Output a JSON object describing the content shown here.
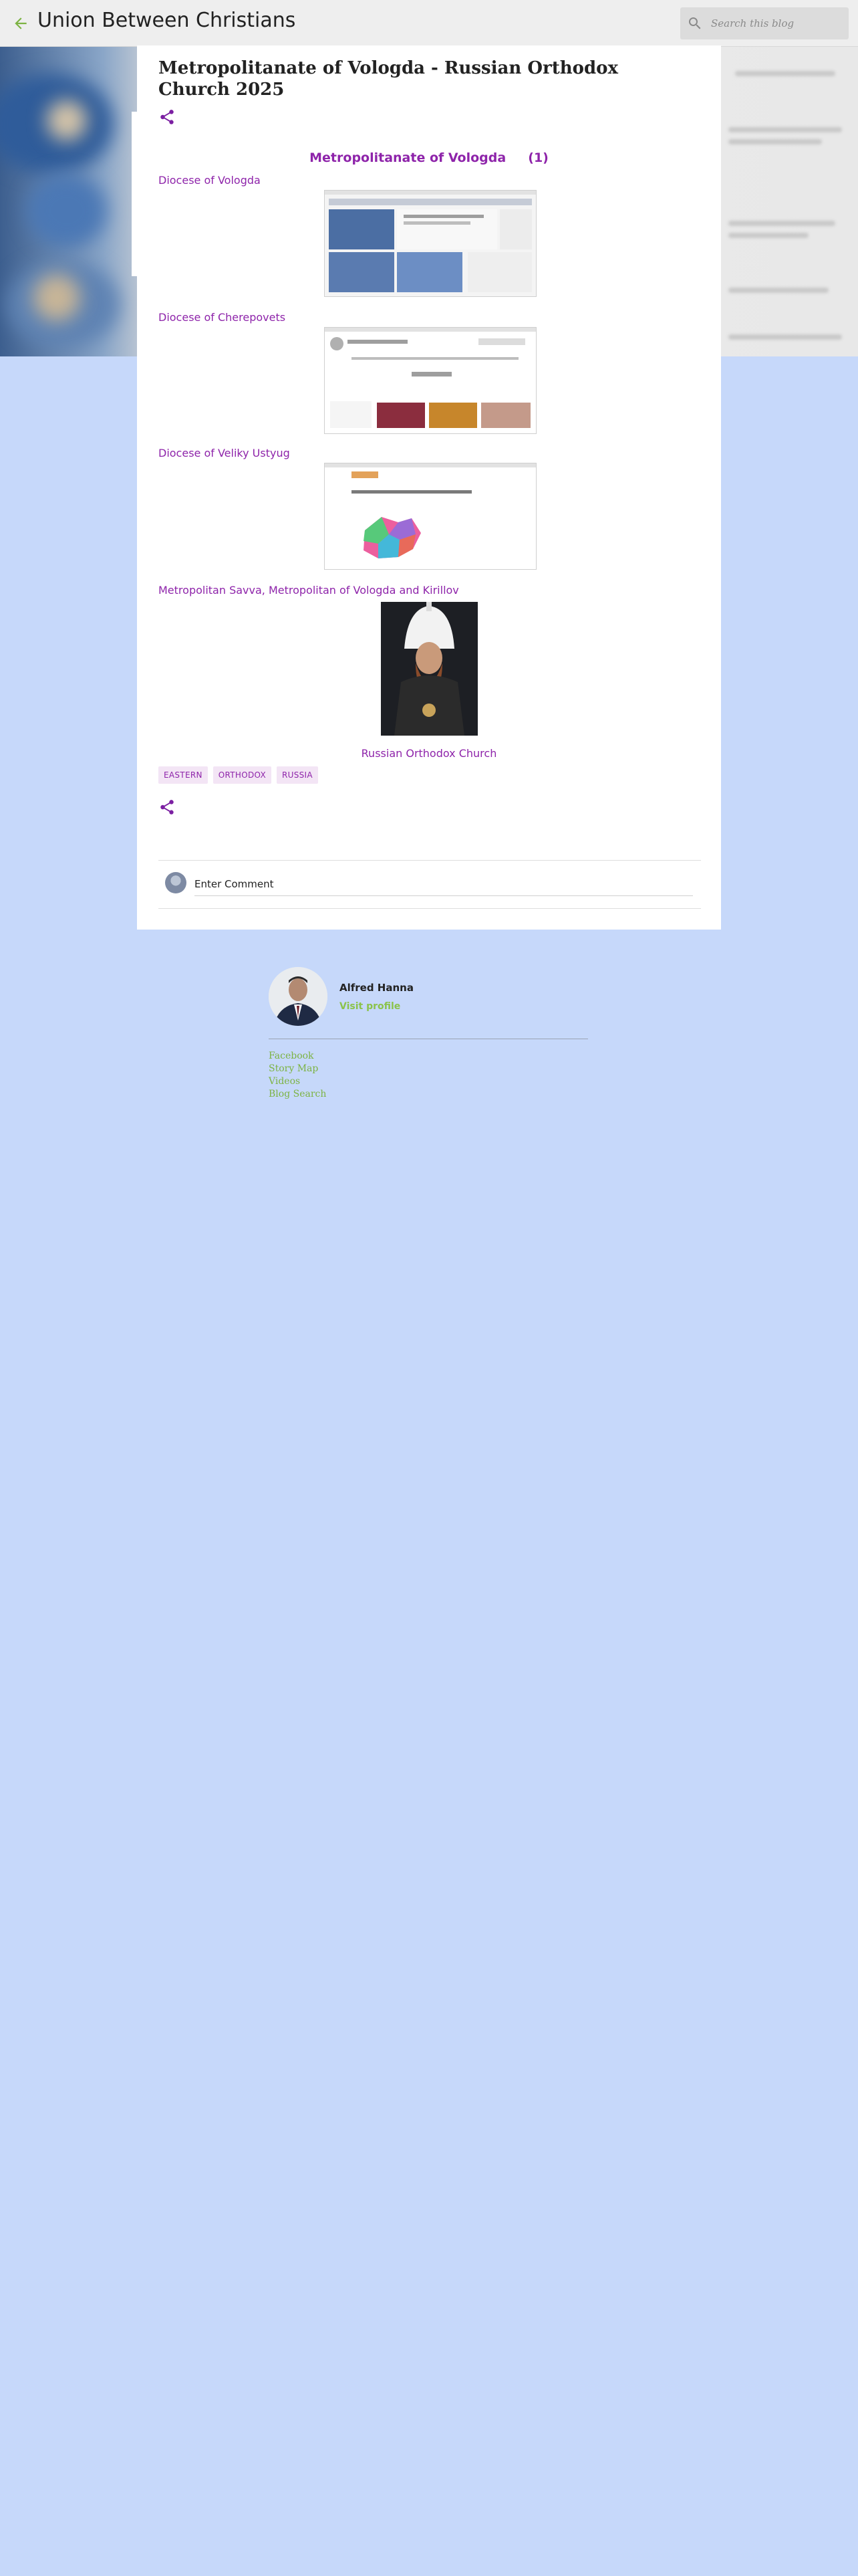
{
  "header": {
    "blog_title": "Union Between Christians",
    "search_placeholder": "Search this blog"
  },
  "post": {
    "title": "Metropolitanate of Vologda - Russian Orthodox Church 2025",
    "heading": "Metropolitanate of Vologda     (1)",
    "sections": [
      {
        "label": "Diocese of Vologda"
      },
      {
        "label": "Diocese of Cherepovets"
      },
      {
        "label": "Diocese of Veliky Ustyug"
      },
      {
        "label": "Metropolitan Savva, Metropolitan of Vologda and Kirillov"
      }
    ],
    "church_link": "Russian Orthodox Church",
    "labels": [
      "EASTERN",
      "ORTHODOX",
      "RUSSIA"
    ],
    "comment_placeholder": "Enter Comment"
  },
  "profile": {
    "name": "Alfred Hanna",
    "visit_label": "Visit profile"
  },
  "footer_links": [
    "Facebook",
    "Story Map",
    "Videos",
    "Blog Search"
  ],
  "colors": {
    "accent_purple": "#8e24aa",
    "accent_green": "#7cb342",
    "page_background": "#c6d8fa"
  }
}
